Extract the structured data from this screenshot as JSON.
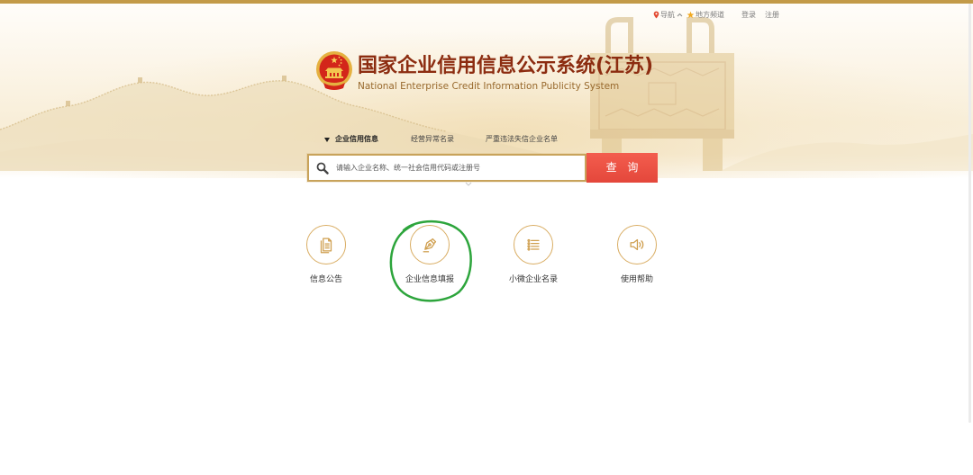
{
  "top_nav": {
    "navigation_label": "导航",
    "navigation_icon": "location-pin-icon",
    "local_channel_label": "地方频道",
    "local_channel_icon": "star-icon",
    "login_label": "登录",
    "register_label": "注册"
  },
  "header": {
    "emblem_icon": "national-emblem-icon",
    "title": "国家企业信用信息公示系统(江苏)",
    "subtitle": "National Enterprise Credit Information Publicity System"
  },
  "search": {
    "tabs": [
      {
        "label": "企业信用信息",
        "active": true
      },
      {
        "label": "经营异常名录",
        "active": false
      },
      {
        "label": "严重违法失信企业名单",
        "active": false
      }
    ],
    "placeholder": "请输入企业名称、统一社会信用代码或注册号",
    "button_label": "查 询"
  },
  "quick_links": [
    {
      "label": "信息公告",
      "icon": "document-icon",
      "highlighted": false
    },
    {
      "label": "企业信息填报",
      "icon": "pen-nib-icon",
      "highlighted": true
    },
    {
      "label": "小微企业名录",
      "icon": "list-icon",
      "highlighted": false
    },
    {
      "label": "使用帮助",
      "icon": "speaker-icon",
      "highlighted": false
    }
  ],
  "colors": {
    "top_strip": "#c39a48",
    "title": "#8c2c10",
    "subtitle": "#98692d",
    "search_border": "#c8a35b",
    "search_button": "#e84c3e",
    "icon_gold": "#d5a85e",
    "highlight_annotation": "#2da53c"
  }
}
